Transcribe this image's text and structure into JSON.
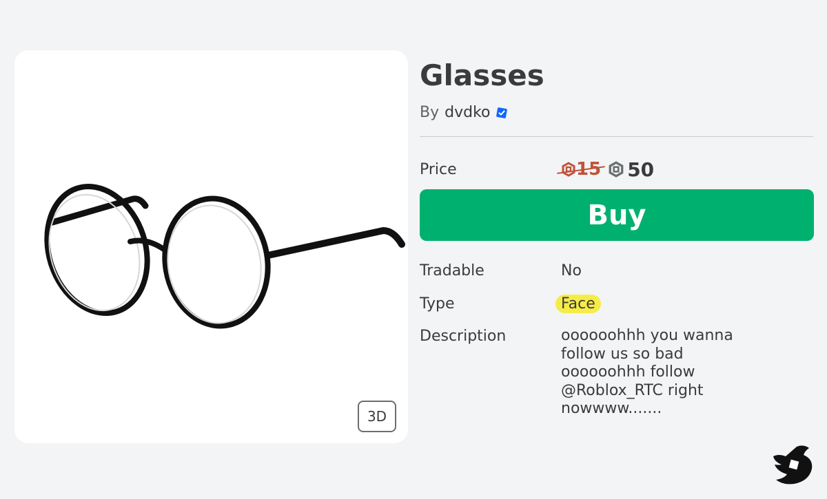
{
  "item": {
    "title": "Glasses",
    "creator_prefix": "By",
    "creator_name": "dvdko",
    "view_3d_label": "3D"
  },
  "price": {
    "label": "Price",
    "original_value": "15",
    "current_value": "50"
  },
  "buy": {
    "label": "Buy"
  },
  "details": {
    "tradable_label": "Tradable",
    "tradable_value": "No",
    "type_label": "Type",
    "type_value": "Face",
    "description_label": "Description",
    "description_lines": [
      "oooooohhh you wanna",
      "follow us so bad",
      "oooooohhh follow",
      "@Roblox_RTC right",
      "nowwww......."
    ]
  },
  "colors": {
    "buy_green": "#00b06f",
    "old_price_red": "#c0523b",
    "highlight_yellow": "#f6ec48",
    "verified_blue": "#1066ff"
  },
  "icons": {
    "verified": "verified-badge-icon",
    "robux": "robux-icon",
    "watermark": "rtc-logo-icon"
  }
}
